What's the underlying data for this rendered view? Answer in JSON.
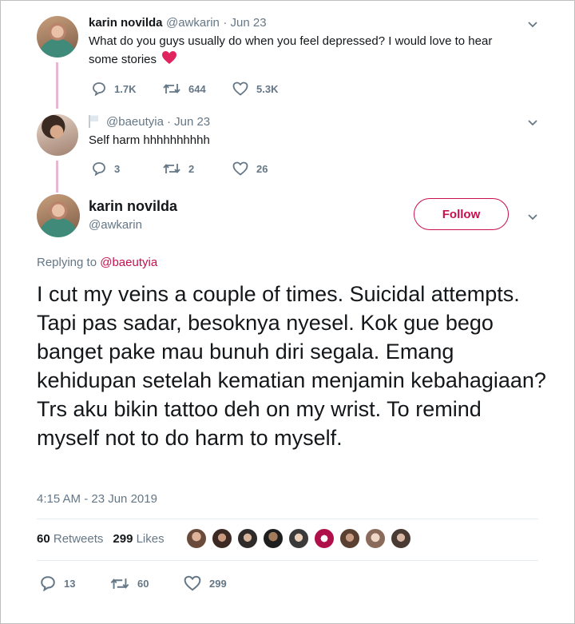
{
  "tweet1": {
    "name": "karin novilda",
    "handle": "@awkarin",
    "date": "· Jun 23",
    "text_line1": "What do you guys usually do when you feel depressed? I would love to hear",
    "text_line2": "some stories",
    "emoji": "heart-emoji",
    "replies": "1.7K",
    "retweets": "644",
    "likes": "5.3K"
  },
  "tweet2": {
    "handle": "@baeutyia",
    "date": "· Jun 23",
    "text": "Self harm hhhhhhhhhh",
    "replies": "3",
    "retweets": "2",
    "likes": "26"
  },
  "main": {
    "name": "karin novilda",
    "handle": "@awkarin",
    "follow_label": "Follow",
    "replying_prefix": "Replying to",
    "replying_to": "@baeutyia",
    "text": "I cut my veins a couple of times. Suicidal attempts. Tapi pas sadar, besoknya nyesel. Kok gue bego banget pake mau bunuh diri segala. Emang kehidupan setelah kematian menjamin kebahagiaan? Trs aku bikin tattoo deh on my wrist. To remind myself not to do harm to myself.",
    "timestamp": "4:15 AM - 23 Jun 2019",
    "retweet_count": "60",
    "retweet_label": "Retweets",
    "like_count": "299",
    "like_label": "Likes",
    "replies": "13",
    "retweets": "60",
    "likes": "299"
  },
  "colors": {
    "accent": "#c8104e",
    "muted": "#657786",
    "thread_line": "#e6b8d2"
  }
}
